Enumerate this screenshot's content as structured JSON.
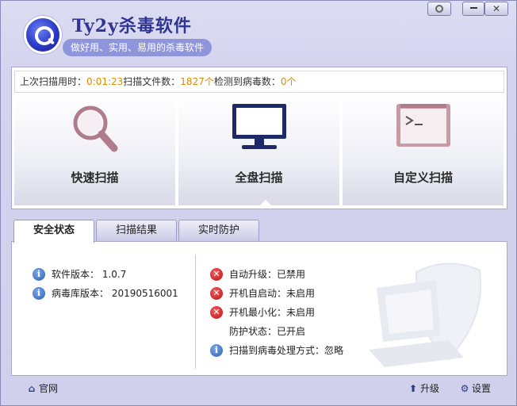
{
  "app": {
    "title": "Ty2y杀毒软件",
    "subtitle": "做好用、实用、易用的杀毒软件"
  },
  "stats": {
    "last_scan_label": "上次扫描用时：",
    "last_scan_value": "0:01:23",
    "files_label": "扫描文件数：",
    "files_value": "1827个",
    "virus_label": "检测到病毒数：",
    "virus_value": "0个"
  },
  "scan_buttons": [
    {
      "label": "快速扫描",
      "icon": "magnifier-icon"
    },
    {
      "label": "全盘扫描",
      "icon": "monitor-icon"
    },
    {
      "label": "自定义扫描",
      "icon": "terminal-icon"
    }
  ],
  "tabs": [
    {
      "label": "安全状态",
      "active": true
    },
    {
      "label": "扫描结果",
      "active": false
    },
    {
      "label": "实时防护",
      "active": false
    }
  ],
  "status_left": [
    {
      "text": "软件版本： 1.0.7",
      "icon": "info-icon"
    },
    {
      "text": "病毒库版本： 20190516001",
      "icon": "info-icon"
    }
  ],
  "status_right": [
    {
      "text": "自动升级：已禁用",
      "icon": "error-icon"
    },
    {
      "text": "开机自启动：未启用",
      "icon": "error-icon"
    },
    {
      "text": "开机最小化：未启用",
      "icon": "error-icon"
    },
    {
      "text": "防护状态：已开启",
      "icon": ""
    },
    {
      "text": "扫描到病毒处理方式：忽略",
      "icon": "info-icon"
    }
  ],
  "footer": {
    "home": "官网",
    "upgrade": "升级",
    "settings": "设置"
  },
  "colors": {
    "accent": "#2f3590",
    "stat_value": "#e08a00",
    "background": "#d4d4ef"
  }
}
